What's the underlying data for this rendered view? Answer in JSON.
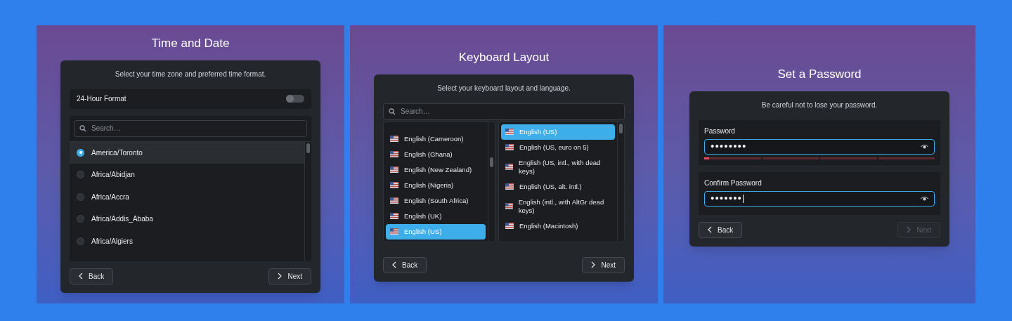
{
  "screens": [
    {
      "kind": "time_date",
      "title": "Time and Date",
      "description": "Select your time zone and preferred time format.",
      "toggle": {
        "label": "24-Hour Format",
        "on": false
      },
      "search": {
        "placeholder": "Search…"
      },
      "timezones": [
        {
          "label": "America/Toronto",
          "selected": true
        },
        {
          "label": "Africa/Abidjan",
          "selected": false
        },
        {
          "label": "Africa/Accra",
          "selected": false
        },
        {
          "label": "Africa/Addis_Ababa",
          "selected": false
        },
        {
          "label": "Africa/Algiers",
          "selected": false
        }
      ],
      "buttons": [
        {
          "kind": "back",
          "label": "Back",
          "disabled": false
        },
        {
          "kind": "next",
          "label": "Next",
          "disabled": false
        }
      ]
    },
    {
      "kind": "keyboard",
      "title": "Keyboard Layout",
      "description": "Select your keyboard layout and language.",
      "search": {
        "placeholder": "Search…"
      },
      "languages": [
        {
          "label": "English (Cameroon)",
          "selected": false
        },
        {
          "label": "English (Ghana)",
          "selected": false
        },
        {
          "label": "English (New Zealand)",
          "selected": false
        },
        {
          "label": "English (Nigeria)",
          "selected": false
        },
        {
          "label": "English (South Africa)",
          "selected": false
        },
        {
          "label": "English (UK)",
          "selected": false
        },
        {
          "label": "English (US)",
          "selected": true
        }
      ],
      "layouts": [
        {
          "label": "English (US)",
          "selected": true
        },
        {
          "label": "English (US, euro on 5)",
          "selected": false
        },
        {
          "label": "English (US, intl., with dead keys)",
          "selected": false
        },
        {
          "label": "English (US, alt. intl.)",
          "selected": false
        },
        {
          "label": "English (intl., with AltGr dead keys)",
          "selected": false
        },
        {
          "label": "English (Macintosh)",
          "selected": false
        }
      ],
      "buttons": [
        {
          "kind": "back",
          "label": "Back",
          "disabled": false
        },
        {
          "kind": "next",
          "label": "Next",
          "disabled": false
        }
      ]
    },
    {
      "kind": "password",
      "title": "Set a Password",
      "description": "Be careful not to lose your password.",
      "fields": [
        {
          "label": "Password",
          "value": "●●●●●●●●",
          "focused": false,
          "strength": {
            "level": 0.02
          }
        },
        {
          "label": "Confirm Password",
          "value": "●●●●●●●",
          "focused": true
        }
      ],
      "buttons": [
        {
          "kind": "back",
          "label": "Back",
          "disabled": false
        },
        {
          "kind": "next",
          "label": "Next",
          "disabled": true
        }
      ]
    }
  ]
}
